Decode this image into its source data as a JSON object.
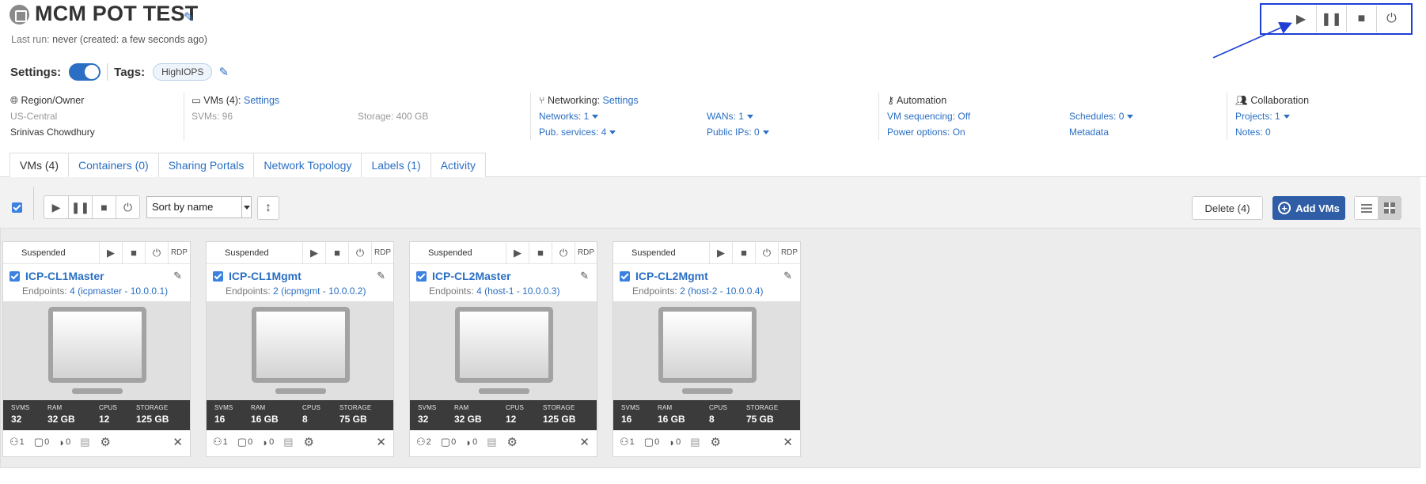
{
  "header": {
    "title": "MCM POT TEST",
    "last_run_label": "Last run:",
    "last_run_value": "never (created: a few seconds ago)"
  },
  "top_controls": [
    "play-icon",
    "pause-icon",
    "stop-icon",
    "power-icon"
  ],
  "settings": {
    "settings_label": "Settings:",
    "tags_label": "Tags:",
    "tag": "HighIOPS"
  },
  "info": {
    "region": {
      "title": "Region/Owner",
      "region": "US-Central",
      "owner": "Srinivas Chowdhury"
    },
    "vms": {
      "title": "VMs (4):",
      "link": "Settings",
      "svms": "SVMs: 96",
      "storage": "Storage: 400 GB"
    },
    "networking": {
      "title": "Networking:",
      "link": "Settings",
      "networks": "Networks: 1",
      "pub_services": "Pub. services: 4",
      "wans": "WANs: 1",
      "public_ips": "Public IPs: 0"
    },
    "automation": {
      "title": "Automation",
      "vm_seq": "VM sequencing: Off",
      "power": "Power options: On",
      "schedules": "Schedules: 0",
      "metadata": "Metadata"
    },
    "collaboration": {
      "title": "Collaboration",
      "projects": "Projects: 1",
      "notes": "Notes: 0"
    }
  },
  "tabs": [
    "VMs (4)",
    "Containers (0)",
    "Sharing Portals",
    "Network Topology",
    "Labels (1)",
    "Activity"
  ],
  "toolbar": {
    "sort": "Sort by name",
    "delete": "Delete (4)",
    "add": "Add VMs"
  },
  "stat_labels": {
    "svms": "SVMS",
    "ram": "RAM",
    "cpus": "CPUS",
    "storage": "STORAGE"
  },
  "vms": [
    {
      "status": "Suspended",
      "rdp": "RDP",
      "name": "ICP-CL1Master",
      "endpoints_label": "Endpoints:",
      "endpoints": "4 (icpmaster - 10.0.0.1)",
      "svms": "32",
      "ram": "32 GB",
      "cpus": "12",
      "storage": "125 GB",
      "users": "1",
      "comments": "0",
      "tags": "0"
    },
    {
      "status": "Suspended",
      "rdp": "RDP",
      "name": "ICP-CL1Mgmt",
      "endpoints_label": "Endpoints:",
      "endpoints": "2 (icpmgmt - 10.0.0.2)",
      "svms": "16",
      "ram": "16 GB",
      "cpus": "8",
      "storage": "75 GB",
      "users": "1",
      "comments": "0",
      "tags": "0"
    },
    {
      "status": "Suspended",
      "rdp": "RDP",
      "name": "ICP-CL2Master",
      "endpoints_label": "Endpoints:",
      "endpoints": "4 (host-1 - 10.0.0.3)",
      "svms": "32",
      "ram": "32 GB",
      "cpus": "12",
      "storage": "125 GB",
      "users": "2",
      "comments": "0",
      "tags": "0"
    },
    {
      "status": "Suspended",
      "rdp": "RDP",
      "name": "ICP-CL2Mgmt",
      "endpoints_label": "Endpoints:",
      "endpoints": "2 (host-2 - 10.0.0.4)",
      "svms": "16",
      "ram": "16 GB",
      "cpus": "8",
      "storage": "75 GB",
      "users": "1",
      "comments": "0",
      "tags": "0"
    }
  ],
  "colors": {
    "accent": "#2a6fc4",
    "primary_button": "#2f5ea6",
    "highlight_box": "#1d3fd6"
  }
}
